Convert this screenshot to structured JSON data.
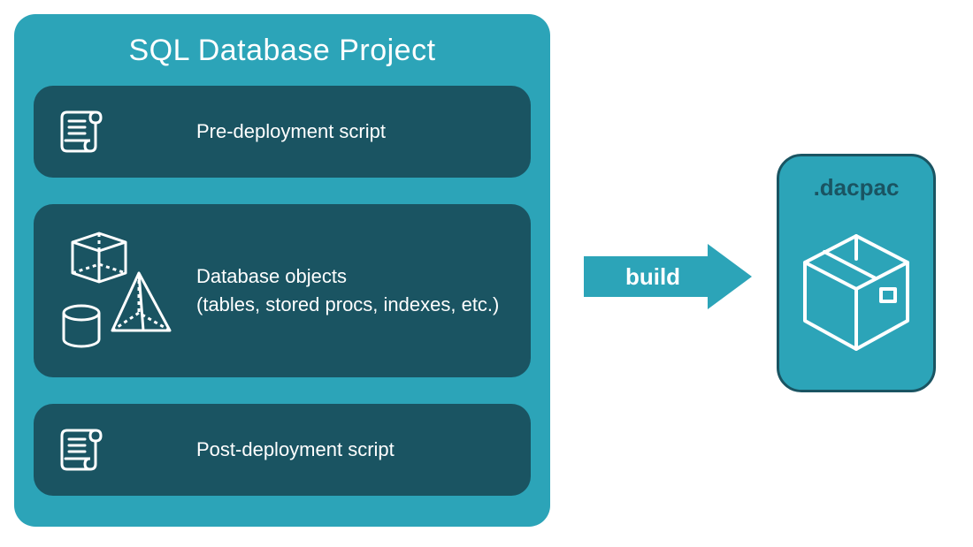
{
  "project": {
    "title": "SQL Database Project",
    "sections": {
      "pre": {
        "label": "Pre-deployment script"
      },
      "objects": {
        "label_line1": "Database objects",
        "label_line2": "(tables, stored procs, indexes, etc.)"
      },
      "post": {
        "label": "Post-deployment script"
      }
    }
  },
  "arrow": {
    "label": "build"
  },
  "output": {
    "label": ".dacpac"
  },
  "colors": {
    "container": "#2CA4B8",
    "card": "#1A5462",
    "stroke_white": "#FFFFFF"
  }
}
